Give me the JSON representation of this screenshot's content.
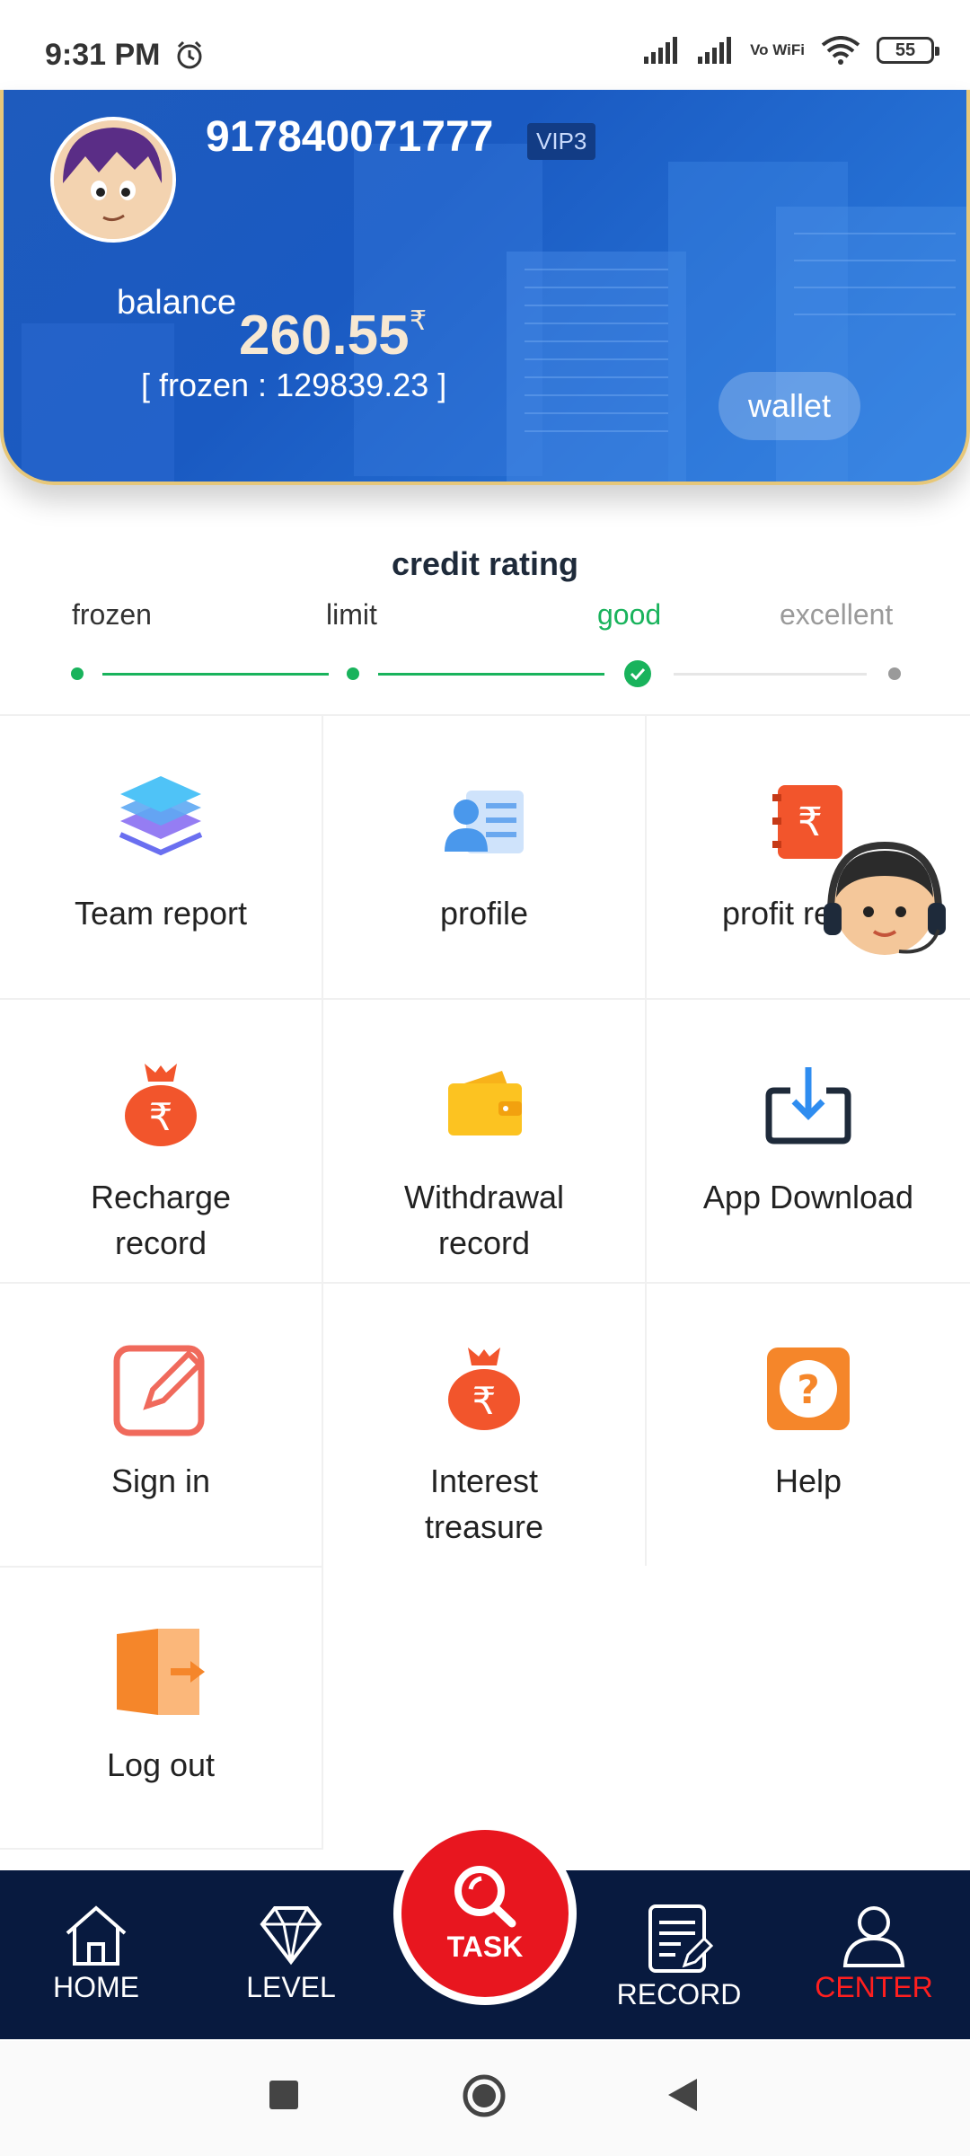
{
  "status_bar": {
    "time": "9:31 PM",
    "volte": "Vo WiFi",
    "battery": "55"
  },
  "header": {
    "phone": "917840071777",
    "vip": "VIP3",
    "balance_label": "balance",
    "balance_value": "260.55",
    "currency": "₹",
    "frozen": "[ frozen : 129839.23 ]",
    "wallet_label": "wallet"
  },
  "credit": {
    "title": "credit rating",
    "levels": [
      "frozen",
      "limit",
      "good",
      "excellent"
    ],
    "current_level": "good",
    "colors": {
      "active": "#19b35c",
      "inactive": "#9a9a9a"
    }
  },
  "menu": [
    {
      "label": "Team report",
      "icon": "layers-icon"
    },
    {
      "label": "profile",
      "icon": "profile-card-icon"
    },
    {
      "label": "profit record",
      "icon": "rupee-book-icon"
    },
    {
      "label": "Recharge record",
      "icon": "money-bag-icon"
    },
    {
      "label": "Withdrawal record",
      "icon": "wallet-icon"
    },
    {
      "label": "App Download",
      "icon": "download-icon"
    },
    {
      "label": "Sign in",
      "icon": "edit-icon"
    },
    {
      "label": "Interest treasure",
      "icon": "money-bag-icon"
    },
    {
      "label": "Help",
      "icon": "question-icon"
    },
    {
      "label": "Log out",
      "icon": "logout-icon"
    }
  ],
  "nav": {
    "home": "HOME",
    "level": "LEVEL",
    "task": "TASK",
    "record": "RECORD",
    "center": "CENTER",
    "active": "center"
  }
}
